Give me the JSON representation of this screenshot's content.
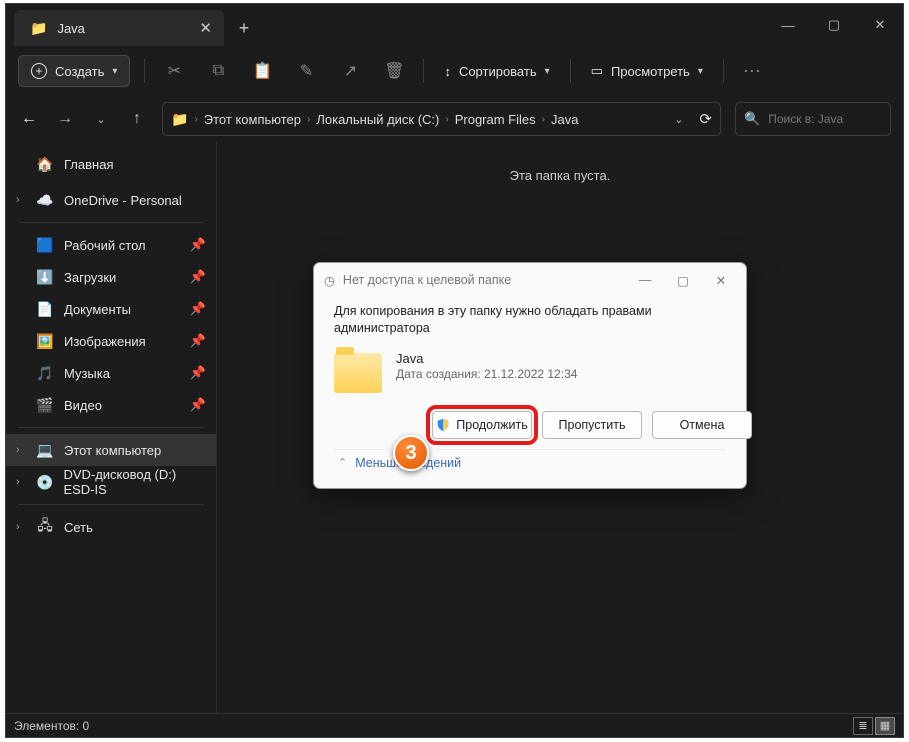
{
  "titlebar": {
    "tab_title": "Java",
    "win_min": "—",
    "win_max": "▢",
    "win_close": "✕"
  },
  "toolbar": {
    "create_label": "Создать",
    "sort_label": "Сортировать",
    "view_label": "Просмотреть"
  },
  "breadcrumb": {
    "items": [
      "Этот компьютер",
      "Локальный диск (C:)",
      "Program Files",
      "Java"
    ]
  },
  "search": {
    "placeholder": "Поиск в: Java"
  },
  "sidebar": {
    "home": "Главная",
    "onedrive": "OneDrive - Personal",
    "quick": [
      {
        "icon": "🟦",
        "label": "Рабочий стол"
      },
      {
        "icon": "⬇️",
        "label": "Загрузки"
      },
      {
        "icon": "📄",
        "label": "Документы"
      },
      {
        "icon": "🖼️",
        "label": "Изображения"
      },
      {
        "icon": "🎵",
        "label": "Музыка"
      },
      {
        "icon": "🎬",
        "label": "Видео"
      }
    ],
    "this_pc": "Этот компьютер",
    "dvd": "DVD-дисковод (D:) ESD-IS",
    "network": "Сеть"
  },
  "content": {
    "empty": "Эта папка пуста."
  },
  "status": {
    "items": "Элементов: 0"
  },
  "dialog": {
    "title": "Нет доступа к целевой папке",
    "message": "Для копирования в эту папку нужно обладать правами администратора",
    "folder_name": "Java",
    "folder_date": "Дата создания: 21.12.2022 12:34",
    "btn_continue": "Продолжить",
    "btn_skip": "Пропустить",
    "btn_cancel": "Отмена",
    "less": "Меньше сведений"
  },
  "callout": "3"
}
